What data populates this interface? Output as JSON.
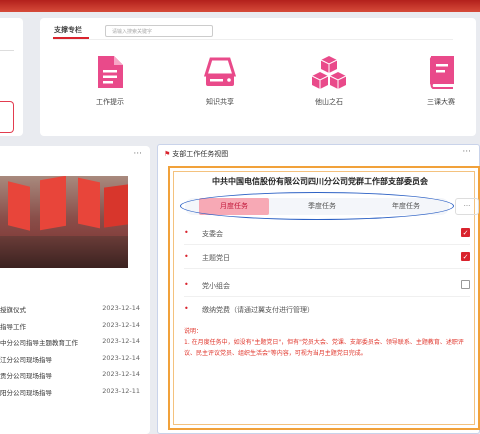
{
  "colors": {
    "accent": "#d9232d",
    "highlight_ring": "#2e62c5",
    "frame": "#f1a13a",
    "tab_active_bg": "#f7a9b5"
  },
  "support": {
    "tab_label": "支撑专栏",
    "search_placeholder": "请输入搜索关键字",
    "tools": [
      {
        "label": "工作提示",
        "icon": "document-icon"
      },
      {
        "label": "知识共享",
        "icon": "drive-icon"
      },
      {
        "label": "他山之石",
        "icon": "cubes-icon"
      },
      {
        "label": "三课大赛",
        "icon": "book-icon"
      }
    ]
  },
  "news": {
    "more_label": "···",
    "items": [
      {
        "title": "授旗仪式",
        "date": "2023-12-14"
      },
      {
        "title": "指导工作",
        "date": "2023-12-14"
      },
      {
        "title": "中分公司指导主题教育工作",
        "date": "2023-12-14"
      },
      {
        "title": "江分公司现场指导",
        "date": "2023-12-14"
      },
      {
        "title": "贡分公司现场指导",
        "date": "2023-12-14"
      },
      {
        "title": "阳分公司现场指导",
        "date": "2023-12-11"
      }
    ]
  },
  "taskview": {
    "title": "支部工作任务视图",
    "more_label": "···",
    "org_name": "中共中国电信股份有限公司四川分公司党群工作部支部委员会",
    "tabs": [
      {
        "label": "月度任务",
        "active": true
      },
      {
        "label": "季度任务",
        "active": false
      },
      {
        "label": "年度任务",
        "active": false
      }
    ],
    "tabs_more": "···",
    "tasks": [
      {
        "label": "支委会",
        "checked": true
      },
      {
        "label": "主题党日",
        "checked": true
      },
      {
        "label": "党小组会",
        "checked": false
      },
      {
        "label": "缴纳党费（请通过翼支付进行管理）",
        "checked": false
      }
    ],
    "note_title": "说明：",
    "note_text": "1. 在月度任务中，如没有\"主题党日\"，但有\"党员大会、党课、支部委员会、领导联系、主题教育、述职评议、民主评议党员、组织生活会\"等内容，可视为当月主题党日完成。"
  }
}
